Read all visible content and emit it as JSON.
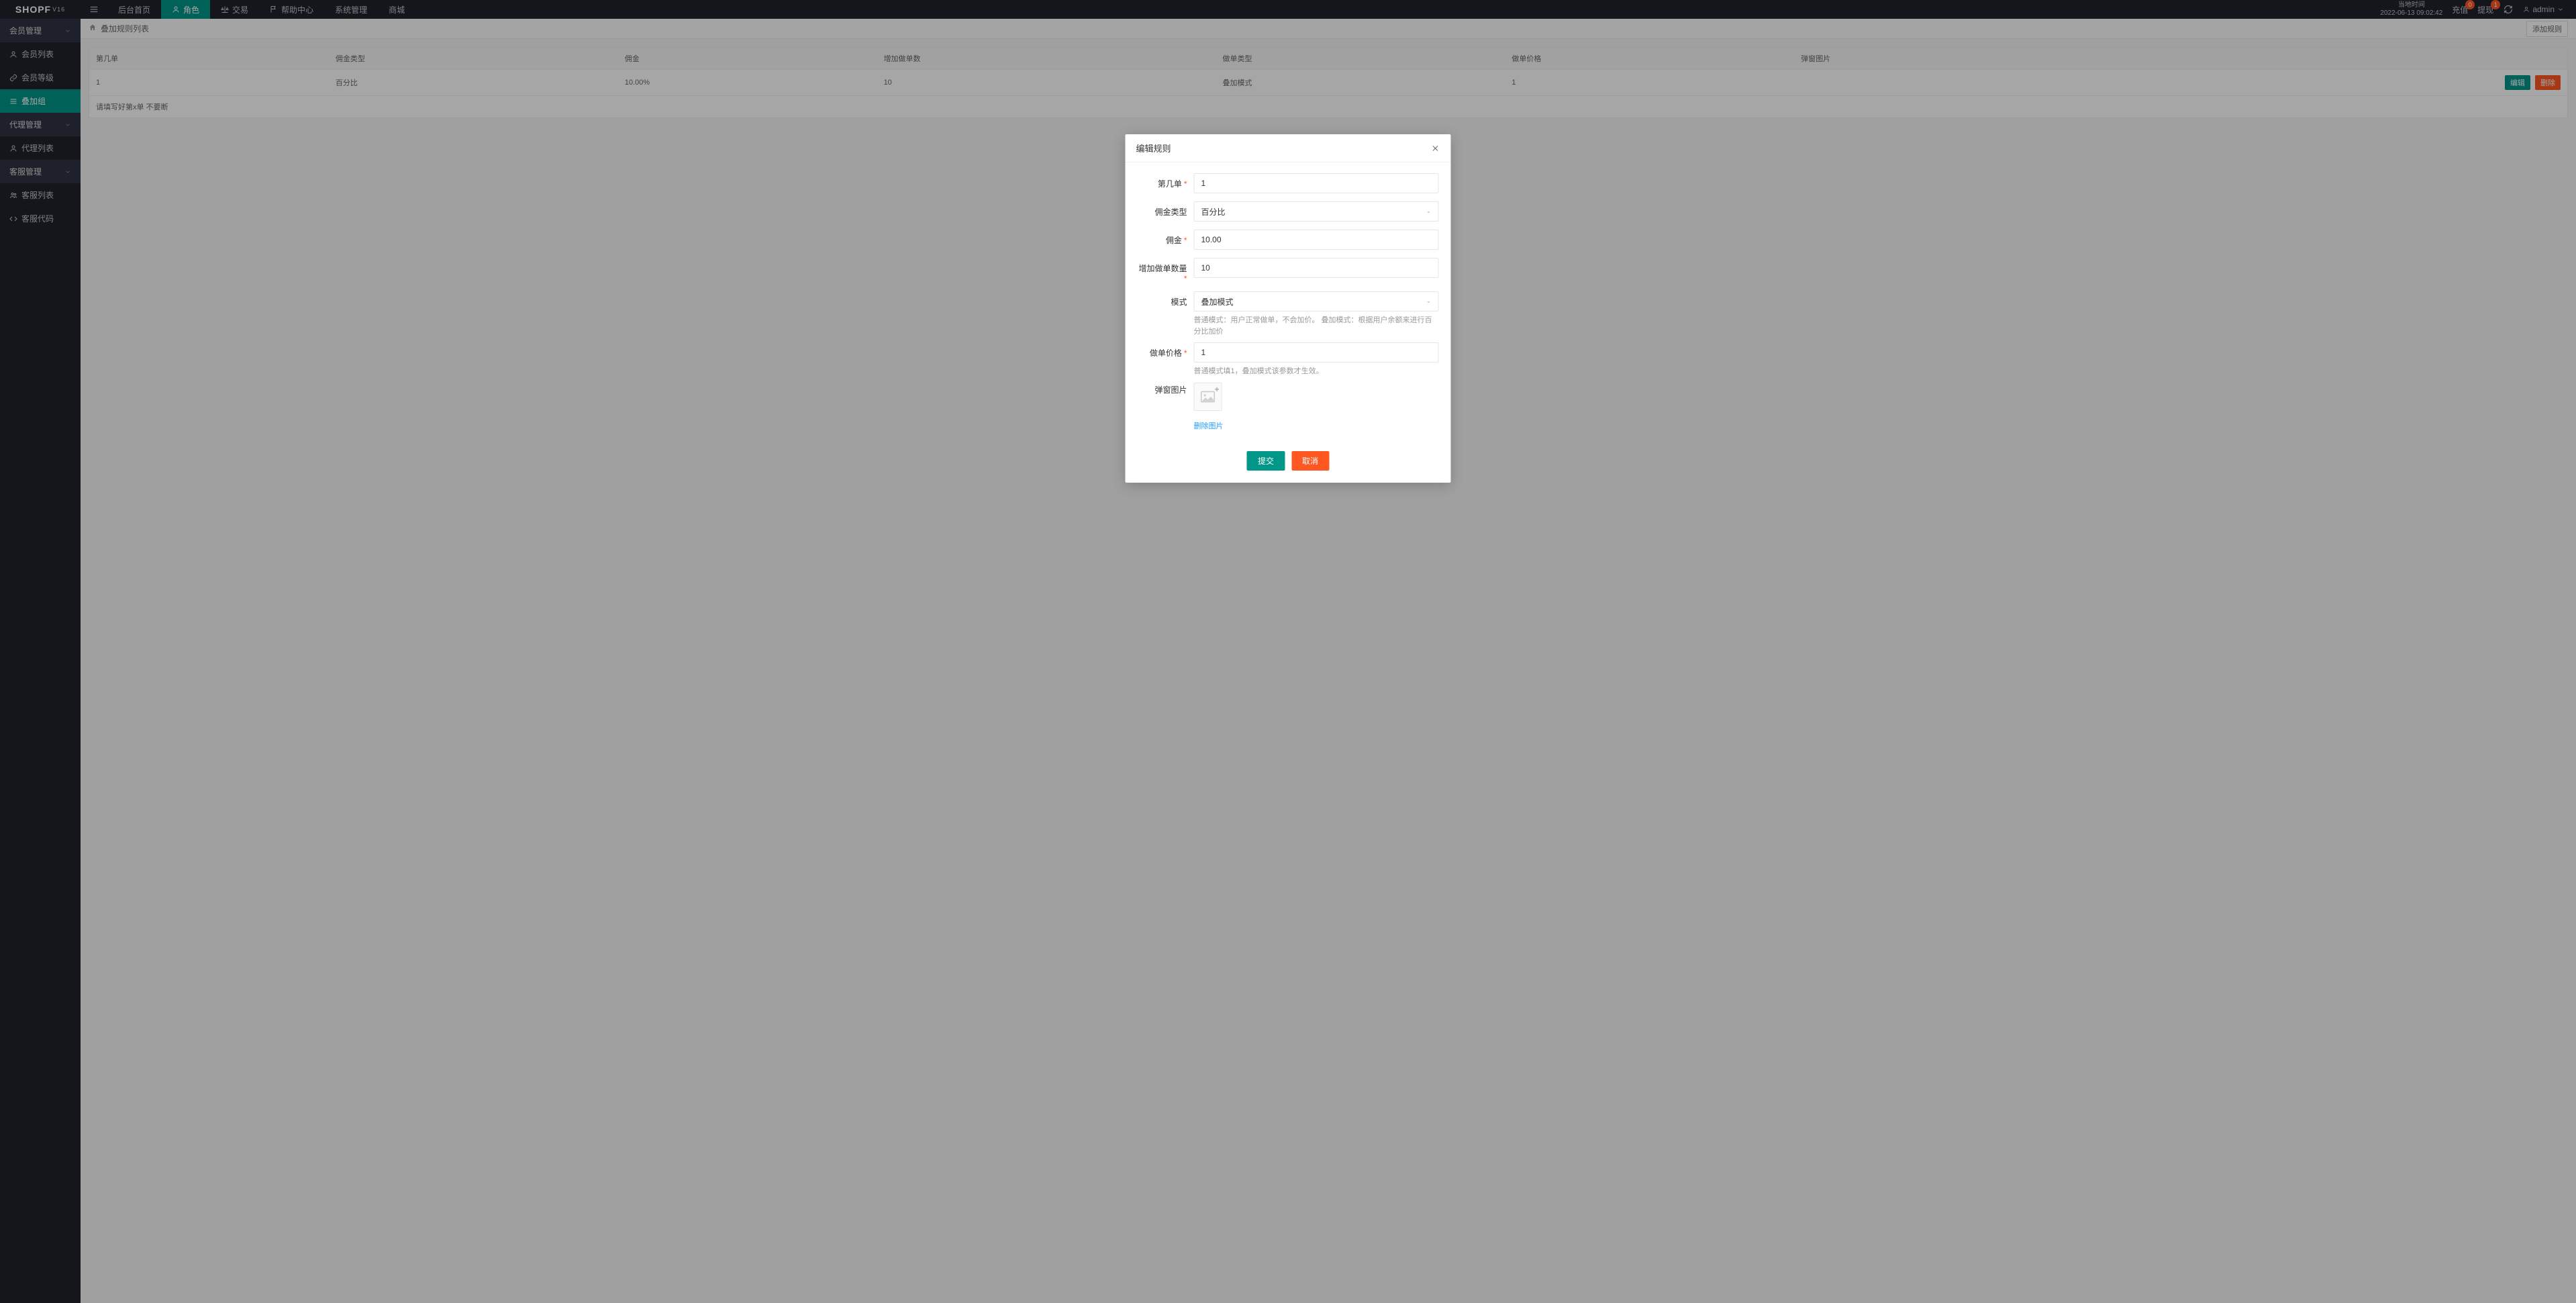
{
  "brand": {
    "name": "SHOPF",
    "version": "V16"
  },
  "topnav": {
    "home": "后台首页",
    "role": "角色",
    "trade": "交易",
    "help": "帮助中心",
    "system": "系统管理",
    "mall": "商城"
  },
  "top_right": {
    "time_label": "当地时间",
    "time_value": "2022-06-13 09:02:42",
    "recharge": "充值",
    "recharge_badge": "0",
    "withdraw": "提现",
    "withdraw_badge": "1",
    "user": "admin"
  },
  "sidebar": {
    "group_member": "会员管理",
    "member_list": "会员列表",
    "member_level": "会员等级",
    "overlay_group": "叠加组",
    "group_agent": "代理管理",
    "agent_list": "代理列表",
    "group_service": "客服管理",
    "service_list": "客服列表",
    "service_code": "客服代码"
  },
  "crumb": {
    "title": "叠加规则列表",
    "add_btn": "添加规则"
  },
  "table": {
    "headers": {
      "order_no": "第几单",
      "comm_type": "佣金类型",
      "commission": "佣金",
      "add_count": "增加做单数",
      "order_type": "做单类型",
      "order_price": "做单价格",
      "popup_img": "弹窗图片"
    },
    "row": {
      "order_no": "1",
      "comm_type": "百分比",
      "commission": "10.00%",
      "add_count": "10",
      "order_type": "叠加模式",
      "order_price": "1",
      "edit": "编辑",
      "del": "删除"
    },
    "hint": "请填写好第x单 不要断"
  },
  "modal": {
    "title": "编辑规则",
    "labels": {
      "order_no": "第几单",
      "comm_type": "佣金类型",
      "commission": "佣金",
      "add_count": "增加做单数量",
      "mode": "模式",
      "order_price": "做单价格",
      "popup_img": "弹窗图片"
    },
    "values": {
      "order_no": "1",
      "comm_type": "百分比",
      "commission": "10.00",
      "add_count": "10",
      "mode": "叠加模式",
      "order_price": "1"
    },
    "helpers": {
      "mode": "普通模式：用户正常做单，不会加价。 叠加模式：根据用户余额来进行百分比加价",
      "price": "普通模式填1，叠加模式该参数才生效。"
    },
    "remove_img": "删除图片",
    "submit": "提交",
    "cancel": "取消"
  }
}
